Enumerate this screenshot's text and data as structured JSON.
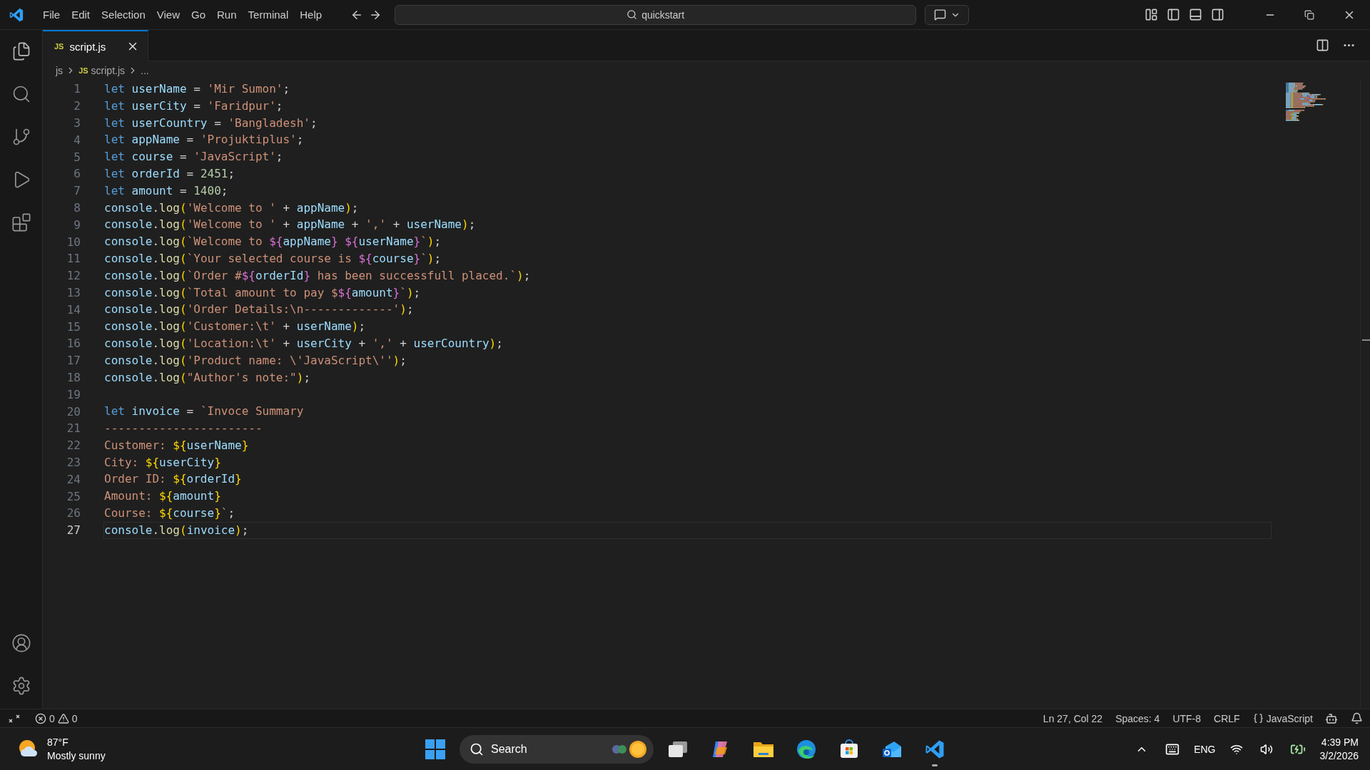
{
  "menu": [
    "File",
    "Edit",
    "Selection",
    "View",
    "Go",
    "Run",
    "Terminal",
    "Help"
  ],
  "command_center": {
    "title": "quickstart"
  },
  "tabs": [
    {
      "badge": "JS",
      "label": "script.js",
      "selected": true
    }
  ],
  "breadcrumb": [
    {
      "label": "js"
    },
    {
      "badge": "JS",
      "label": "script.js"
    },
    {
      "label": "..."
    }
  ],
  "editor": {
    "lines": [
      {
        "number": "1",
        "current": false,
        "tokens": [
          {
            "kind": "keyword",
            "text": "let "
          },
          {
            "kind": "variable",
            "text": "userName"
          },
          {
            "kind": "punct",
            "text": " = "
          },
          {
            "kind": "string",
            "text": "'Mir Sumon'"
          },
          {
            "kind": "punct",
            "text": ";"
          }
        ]
      },
      {
        "number": "2",
        "current": false,
        "tokens": [
          {
            "kind": "keyword",
            "text": "let "
          },
          {
            "kind": "variable",
            "text": "userCity"
          },
          {
            "kind": "punct",
            "text": " = "
          },
          {
            "kind": "string",
            "text": "'Faridpur'"
          },
          {
            "kind": "punct",
            "text": ";"
          }
        ]
      },
      {
        "number": "3",
        "current": false,
        "tokens": [
          {
            "kind": "keyword",
            "text": "let "
          },
          {
            "kind": "variable",
            "text": "userCountry"
          },
          {
            "kind": "punct",
            "text": " = "
          },
          {
            "kind": "string",
            "text": "'Bangladesh'"
          },
          {
            "kind": "punct",
            "text": ";"
          }
        ]
      },
      {
        "number": "4",
        "current": false,
        "tokens": [
          {
            "kind": "keyword",
            "text": "let "
          },
          {
            "kind": "variable",
            "text": "appName"
          },
          {
            "kind": "punct",
            "text": " = "
          },
          {
            "kind": "string",
            "text": "'Projuktiplus'"
          },
          {
            "kind": "punct",
            "text": ";"
          }
        ]
      },
      {
        "number": "5",
        "current": false,
        "tokens": [
          {
            "kind": "keyword",
            "text": "let "
          },
          {
            "kind": "variable",
            "text": "course"
          },
          {
            "kind": "punct",
            "text": " = "
          },
          {
            "kind": "string",
            "text": "'JavaScript'"
          },
          {
            "kind": "punct",
            "text": ";"
          }
        ]
      },
      {
        "number": "6",
        "current": false,
        "tokens": [
          {
            "kind": "keyword",
            "text": "let "
          },
          {
            "kind": "variable",
            "text": "orderId"
          },
          {
            "kind": "punct",
            "text": " = "
          },
          {
            "kind": "number",
            "text": "2451"
          },
          {
            "kind": "punct",
            "text": ";"
          }
        ]
      },
      {
        "number": "7",
        "current": false,
        "tokens": [
          {
            "kind": "keyword",
            "text": "let "
          },
          {
            "kind": "variable",
            "text": "amount"
          },
          {
            "kind": "punct",
            "text": " = "
          },
          {
            "kind": "number",
            "text": "1400"
          },
          {
            "kind": "punct",
            "text": ";"
          }
        ]
      },
      {
        "number": "8",
        "current": false,
        "tokens": [
          {
            "kind": "variable",
            "text": "console"
          },
          {
            "kind": "punct",
            "text": "."
          },
          {
            "kind": "function",
            "text": "log"
          },
          {
            "kind": "bracket1",
            "text": "("
          },
          {
            "kind": "string",
            "text": "'Welcome to '"
          },
          {
            "kind": "punct",
            "text": " + "
          },
          {
            "kind": "variable",
            "text": "appName"
          },
          {
            "kind": "bracket1",
            "text": ")"
          },
          {
            "kind": "punct",
            "text": ";"
          }
        ]
      },
      {
        "number": "9",
        "current": false,
        "tokens": [
          {
            "kind": "variable",
            "text": "console"
          },
          {
            "kind": "punct",
            "text": "."
          },
          {
            "kind": "function",
            "text": "log"
          },
          {
            "kind": "bracket1",
            "text": "("
          },
          {
            "kind": "string",
            "text": "'Welcome to '"
          },
          {
            "kind": "punct",
            "text": " + "
          },
          {
            "kind": "variable",
            "text": "appName"
          },
          {
            "kind": "punct",
            "text": " + "
          },
          {
            "kind": "string",
            "text": "','"
          },
          {
            "kind": "punct",
            "text": " + "
          },
          {
            "kind": "variable",
            "text": "userName"
          },
          {
            "kind": "bracket1",
            "text": ")"
          },
          {
            "kind": "punct",
            "text": ";"
          }
        ]
      },
      {
        "number": "10",
        "current": false,
        "tokens": [
          {
            "kind": "variable",
            "text": "console"
          },
          {
            "kind": "punct",
            "text": "."
          },
          {
            "kind": "function",
            "text": "log"
          },
          {
            "kind": "bracket1",
            "text": "("
          },
          {
            "kind": "string",
            "text": "`Welcome to "
          },
          {
            "kind": "bracket2",
            "text": "${"
          },
          {
            "kind": "variable",
            "text": "appName"
          },
          {
            "kind": "bracket2",
            "text": "}"
          },
          {
            "kind": "bracket2",
            "text": " ${"
          },
          {
            "kind": "variable",
            "text": "userName"
          },
          {
            "kind": "bracket2",
            "text": "}"
          },
          {
            "kind": "string",
            "text": "`"
          },
          {
            "kind": "bracket1",
            "text": ")"
          },
          {
            "kind": "punct",
            "text": ";"
          }
        ]
      },
      {
        "number": "11",
        "current": false,
        "tokens": [
          {
            "kind": "variable",
            "text": "console"
          },
          {
            "kind": "punct",
            "text": "."
          },
          {
            "kind": "function",
            "text": "log"
          },
          {
            "kind": "bracket1",
            "text": "("
          },
          {
            "kind": "string",
            "text": "`Your selected course is "
          },
          {
            "kind": "bracket2",
            "text": "${"
          },
          {
            "kind": "variable",
            "text": "course"
          },
          {
            "kind": "bracket2",
            "text": "}"
          },
          {
            "kind": "string",
            "text": "`"
          },
          {
            "kind": "bracket1",
            "text": ")"
          },
          {
            "kind": "punct",
            "text": ";"
          }
        ]
      },
      {
        "number": "12",
        "current": false,
        "tokens": [
          {
            "kind": "variable",
            "text": "console"
          },
          {
            "kind": "punct",
            "text": "."
          },
          {
            "kind": "function",
            "text": "log"
          },
          {
            "kind": "bracket1",
            "text": "("
          },
          {
            "kind": "string",
            "text": "`Order #"
          },
          {
            "kind": "bracket2",
            "text": "${"
          },
          {
            "kind": "variable",
            "text": "orderId"
          },
          {
            "kind": "bracket2",
            "text": "}"
          },
          {
            "kind": "string",
            "text": " has been successfull placed.`"
          },
          {
            "kind": "bracket1",
            "text": ")"
          },
          {
            "kind": "punct",
            "text": ";"
          }
        ]
      },
      {
        "number": "13",
        "current": false,
        "tokens": [
          {
            "kind": "variable",
            "text": "console"
          },
          {
            "kind": "punct",
            "text": "."
          },
          {
            "kind": "function",
            "text": "log"
          },
          {
            "kind": "bracket1",
            "text": "("
          },
          {
            "kind": "string",
            "text": "`Total amount to pay $"
          },
          {
            "kind": "bracket2",
            "text": "${"
          },
          {
            "kind": "variable",
            "text": "amount"
          },
          {
            "kind": "bracket2",
            "text": "}"
          },
          {
            "kind": "string",
            "text": "`"
          },
          {
            "kind": "bracket1",
            "text": ")"
          },
          {
            "kind": "punct",
            "text": ";"
          }
        ]
      },
      {
        "number": "14",
        "current": false,
        "tokens": [
          {
            "kind": "variable",
            "text": "console"
          },
          {
            "kind": "punct",
            "text": "."
          },
          {
            "kind": "function",
            "text": "log"
          },
          {
            "kind": "bracket1",
            "text": "("
          },
          {
            "kind": "string",
            "text": "'Order Details:\\n-------------'"
          },
          {
            "kind": "bracket1",
            "text": ")"
          },
          {
            "kind": "punct",
            "text": ";"
          }
        ]
      },
      {
        "number": "15",
        "current": false,
        "tokens": [
          {
            "kind": "variable",
            "text": "console"
          },
          {
            "kind": "punct",
            "text": "."
          },
          {
            "kind": "function",
            "text": "log"
          },
          {
            "kind": "bracket1",
            "text": "("
          },
          {
            "kind": "string",
            "text": "'Customer:\\t'"
          },
          {
            "kind": "punct",
            "text": " + "
          },
          {
            "kind": "variable",
            "text": "userName"
          },
          {
            "kind": "bracket1",
            "text": ")"
          },
          {
            "kind": "punct",
            "text": ";"
          }
        ]
      },
      {
        "number": "16",
        "current": false,
        "tokens": [
          {
            "kind": "variable",
            "text": "console"
          },
          {
            "kind": "punct",
            "text": "."
          },
          {
            "kind": "function",
            "text": "log"
          },
          {
            "kind": "bracket1",
            "text": "("
          },
          {
            "kind": "string",
            "text": "'Location:\\t'"
          },
          {
            "kind": "punct",
            "text": " + "
          },
          {
            "kind": "variable",
            "text": "userCity"
          },
          {
            "kind": "punct",
            "text": " + "
          },
          {
            "kind": "string",
            "text": "','"
          },
          {
            "kind": "punct",
            "text": " + "
          },
          {
            "kind": "variable",
            "text": "userCountry"
          },
          {
            "kind": "bracket1",
            "text": ")"
          },
          {
            "kind": "punct",
            "text": ";"
          }
        ]
      },
      {
        "number": "17",
        "current": false,
        "tokens": [
          {
            "kind": "variable",
            "text": "console"
          },
          {
            "kind": "punct",
            "text": "."
          },
          {
            "kind": "function",
            "text": "log"
          },
          {
            "kind": "bracket1",
            "text": "("
          },
          {
            "kind": "string",
            "text": "'Product name: \\'JavaScript\\''"
          },
          {
            "kind": "bracket1",
            "text": ")"
          },
          {
            "kind": "punct",
            "text": ";"
          }
        ]
      },
      {
        "number": "18",
        "current": false,
        "tokens": [
          {
            "kind": "variable",
            "text": "console"
          },
          {
            "kind": "punct",
            "text": "."
          },
          {
            "kind": "function",
            "text": "log"
          },
          {
            "kind": "bracket1",
            "text": "("
          },
          {
            "kind": "string",
            "text": "\"Author's note:\""
          },
          {
            "kind": "bracket1",
            "text": ")"
          },
          {
            "kind": "punct",
            "text": ";"
          }
        ]
      },
      {
        "number": "19",
        "current": false
      },
      {
        "number": "20",
        "current": false,
        "tokens": [
          {
            "kind": "keyword",
            "text": "let "
          },
          {
            "kind": "variable",
            "text": "invoice"
          },
          {
            "kind": "punct",
            "text": " = "
          },
          {
            "kind": "string",
            "text": "`Invoce Summary"
          }
        ]
      },
      {
        "number": "21",
        "current": false,
        "tokens": [
          {
            "kind": "string",
            "text": "-----------------------"
          }
        ]
      },
      {
        "number": "22",
        "current": false,
        "tokens": [
          {
            "kind": "string",
            "text": "Customer: "
          },
          {
            "kind": "bracket1",
            "text": "${"
          },
          {
            "kind": "variable",
            "text": "userName"
          },
          {
            "kind": "bracket1",
            "text": "}"
          }
        ]
      },
      {
        "number": "23",
        "current": false,
        "tokens": [
          {
            "kind": "string",
            "text": "City: "
          },
          {
            "kind": "bracket1",
            "text": "${"
          },
          {
            "kind": "variable",
            "text": "userCity"
          },
          {
            "kind": "bracket1",
            "text": "}"
          }
        ]
      },
      {
        "number": "24",
        "current": false,
        "tokens": [
          {
            "kind": "string",
            "text": "Order ID: "
          },
          {
            "kind": "bracket1",
            "text": "${"
          },
          {
            "kind": "variable",
            "text": "orderId"
          },
          {
            "kind": "bracket1",
            "text": "}"
          }
        ]
      },
      {
        "number": "25",
        "current": false,
        "tokens": [
          {
            "kind": "string",
            "text": "Amount: "
          },
          {
            "kind": "bracket1",
            "text": "${"
          },
          {
            "kind": "variable",
            "text": "amount"
          },
          {
            "kind": "bracket1",
            "text": "}"
          }
        ]
      },
      {
        "number": "26",
        "current": false,
        "tokens": [
          {
            "kind": "string",
            "text": "Course: "
          },
          {
            "kind": "bracket1",
            "text": "${"
          },
          {
            "kind": "variable",
            "text": "course"
          },
          {
            "kind": "bracket1",
            "text": "}"
          },
          {
            "kind": "string",
            "text": "`"
          },
          {
            "kind": "punct",
            "text": ";"
          }
        ]
      },
      {
        "number": "27",
        "current": true,
        "tokens": [
          {
            "kind": "variable",
            "text": "console"
          },
          {
            "kind": "punct",
            "text": "."
          },
          {
            "kind": "function",
            "text": "log"
          },
          {
            "kind": "bracket1",
            "text": "("
          },
          {
            "kind": "variable",
            "text": "invoice"
          },
          {
            "kind": "bracket1",
            "text": ")"
          },
          {
            "kind": "punct",
            "text": ";"
          }
        ]
      }
    ]
  },
  "status_bar": {
    "errors": "0",
    "warnings": "0",
    "items": [
      "Ln 27, Col 22",
      "Spaces: 4",
      "UTF-8",
      "CRLF"
    ],
    "language": "JavaScript"
  },
  "taskbar": {
    "weather": {
      "temperature": "87°F",
      "condition": "Mostly sunny"
    },
    "search": {
      "placeholder": "Search"
    },
    "apps": [
      {
        "kind": "taskview",
        "running": false
      },
      {
        "kind": "copilot",
        "running": false
      },
      {
        "kind": "files",
        "running": false
      },
      {
        "kind": "edge",
        "running": false
      },
      {
        "kind": "store",
        "running": false
      },
      {
        "kind": "outlook",
        "running": false
      },
      {
        "kind": "vscode",
        "running": true
      }
    ],
    "tray": {
      "language": "ENG",
      "time": "4:39 PM",
      "date": "3/2/2026"
    }
  }
}
